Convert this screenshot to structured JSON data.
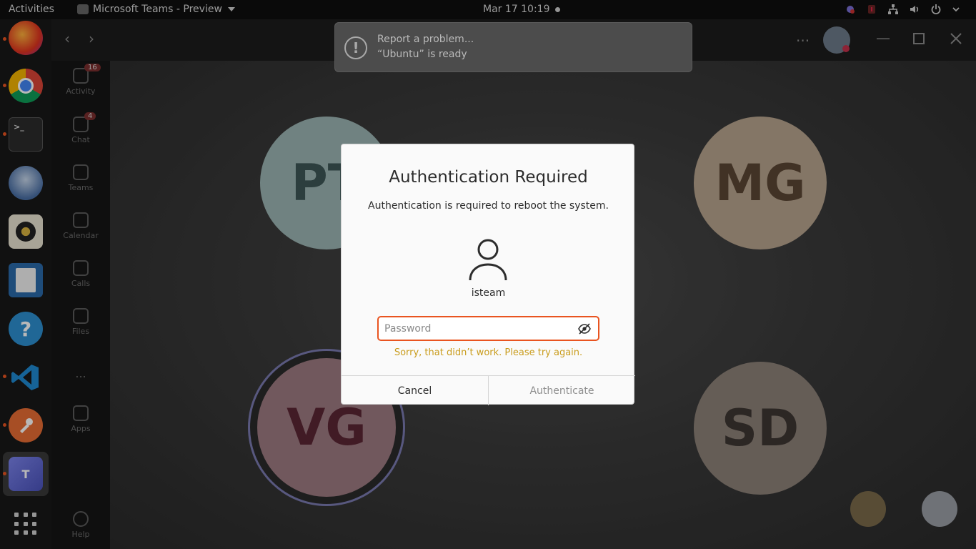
{
  "topbar": {
    "activities": "Activities",
    "app_name": "Microsoft Teams - Preview",
    "clock": "Mar 17  10:19"
  },
  "dock": {
    "items": [
      "firefox-icon",
      "chrome-icon",
      "terminal-icon",
      "thunderbird-icon",
      "rhythmbox-icon",
      "libreoffice-writer-icon",
      "help-icon",
      "vscode-icon",
      "postman-icon",
      "teams-icon"
    ],
    "show_apps": "show-apps-icon"
  },
  "teams": {
    "rail": [
      {
        "label": "Activity",
        "badge": "16"
      },
      {
        "label": "Chat",
        "badge": "4"
      },
      {
        "label": "Teams",
        "badge": ""
      },
      {
        "label": "Calendar",
        "badge": ""
      },
      {
        "label": "Calls",
        "badge": ""
      },
      {
        "label": "Files",
        "badge": ""
      },
      {
        "label": "...",
        "badge": ""
      },
      {
        "label": "Apps",
        "badge": ""
      },
      {
        "label": "Help",
        "badge": ""
      }
    ],
    "tiles": [
      {
        "initials": "PT",
        "bg": "#9cb5b3",
        "fg": "#3e5757"
      },
      {
        "initials": "MG",
        "bg": "#b8a48e",
        "fg": "#5a4634"
      },
      {
        "initials": "VG",
        "bg": "#9d7a82",
        "fg": "#5a2634"
      },
      {
        "initials": "SD",
        "bg": "#8d8178",
        "fg": "#3e3632"
      }
    ],
    "more": "..."
  },
  "notification": {
    "line1": "Report a problem...",
    "line2": "“Ubuntu” is ready"
  },
  "dialog": {
    "title": "Authentication Required",
    "message": "Authentication is required to reboot the system.",
    "username": "isteam",
    "password_placeholder": "Password",
    "password_value": "",
    "error": "Sorry, that didn’t work. Please try again.",
    "cancel": "Cancel",
    "authenticate": "Authenticate"
  },
  "colors": {
    "accent": "#e95420",
    "error": "#c99c1c"
  }
}
